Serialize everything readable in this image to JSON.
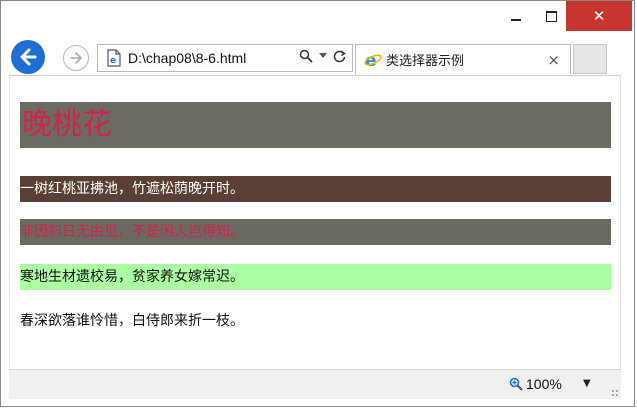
{
  "window": {
    "controls": {
      "minimize": "minimize-icon",
      "maximize": "maximize-icon",
      "close": "close-icon"
    }
  },
  "nav": {
    "address": "D:\\chap08\\8-6.html",
    "search_icon": "search-icon",
    "dropdown_icon": "chevron-down-icon",
    "refresh_icon": "refresh-icon"
  },
  "tab": {
    "title": "类选择器示例",
    "close_label": "×"
  },
  "content": {
    "heading": "晚桃花",
    "lines": [
      "一树红桃亚拂池，竹遮松荫晚开时。",
      "非因斜日无由见，不是闲人岂得知。",
      "寒地生材遗校易，贫家养女嫁常迟。",
      "春深欲落谁怜惜，白侍郎来折一枝。"
    ]
  },
  "status": {
    "zoom": "100%"
  },
  "colors": {
    "accent": "#1f6ed5",
    "close": "#c7352e",
    "heading_bg": "#6b6b62",
    "heading_text": "#d4204c",
    "line1_bg": "#5a3f35",
    "line2_bg": "#6a6a60",
    "line3_bg": "#adfea2"
  }
}
